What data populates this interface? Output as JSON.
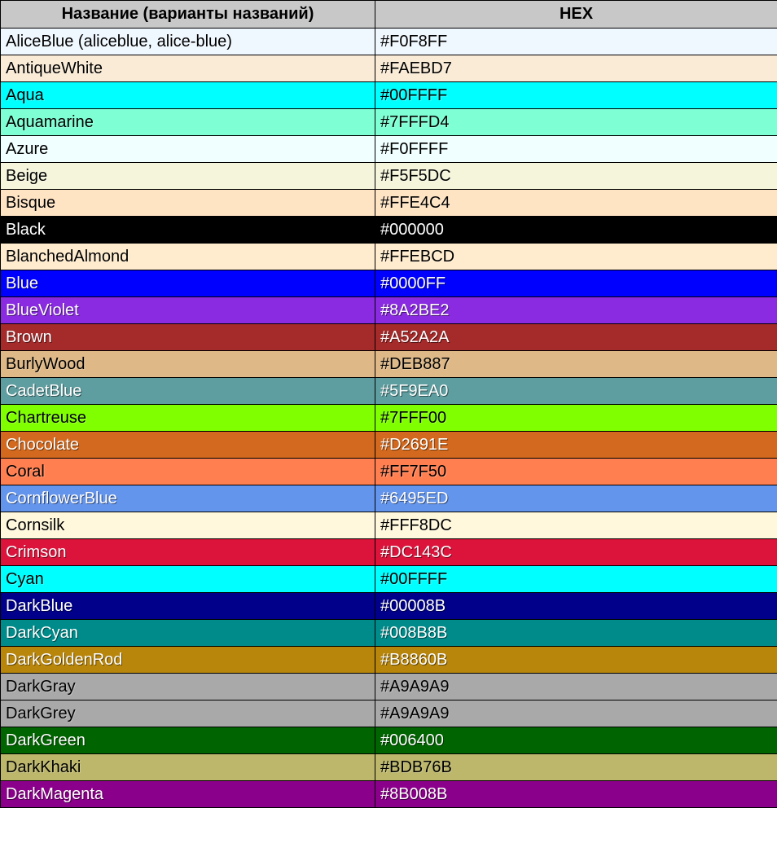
{
  "headers": {
    "name": "Название (варианты названий)",
    "hex": "HEX"
  },
  "rows": [
    {
      "label": "AliceBlue (aliceblue, alice-blue)",
      "hex": "#F0F8FF",
      "bg": "#F0F8FF",
      "fg": "#000000",
      "dark": false
    },
    {
      "label": "AntiqueWhite",
      "hex": "#FAEBD7",
      "bg": "#FAEBD7",
      "fg": "#000000",
      "dark": false
    },
    {
      "label": "Aqua",
      "hex": "#00FFFF",
      "bg": "#00FFFF",
      "fg": "#000000",
      "dark": false
    },
    {
      "label": "Aquamarine",
      "hex": "#7FFFD4",
      "bg": "#7FFFD4",
      "fg": "#000000",
      "dark": false
    },
    {
      "label": "Azure",
      "hex": "#F0FFFF",
      "bg": "#F0FFFF",
      "fg": "#000000",
      "dark": false
    },
    {
      "label": "Beige",
      "hex": "#F5F5DC",
      "bg": "#F5F5DC",
      "fg": "#000000",
      "dark": false
    },
    {
      "label": "Bisque",
      "hex": "#FFE4C4",
      "bg": "#FFE4C4",
      "fg": "#000000",
      "dark": false
    },
    {
      "label": "Black",
      "hex": "#000000",
      "bg": "#000000",
      "fg": "#FFFFFF",
      "dark": true
    },
    {
      "label": "BlanchedAlmond",
      "hex": "#FFEBCD",
      "bg": "#FFEBCD",
      "fg": "#000000",
      "dark": false
    },
    {
      "label": "Blue",
      "hex": "#0000FF",
      "bg": "#0000FF",
      "fg": "#FFFFFF",
      "dark": true
    },
    {
      "label": "BlueViolet",
      "hex": "#8A2BE2",
      "bg": "#8A2BE2",
      "fg": "#FFFFFF",
      "dark": true
    },
    {
      "label": "Brown",
      "hex": "#A52A2A",
      "bg": "#A52A2A",
      "fg": "#FFFFFF",
      "dark": true
    },
    {
      "label": "BurlyWood",
      "hex": "#DEB887",
      "bg": "#DEB887",
      "fg": "#000000",
      "dark": false
    },
    {
      "label": "CadetBlue",
      "hex": "#5F9EA0",
      "bg": "#5F9EA0",
      "fg": "#FFFFFF",
      "dark": true
    },
    {
      "label": "Chartreuse",
      "hex": "#7FFF00",
      "bg": "#7FFF00",
      "fg": "#000000",
      "dark": false
    },
    {
      "label": "Chocolate",
      "hex": "#D2691E",
      "bg": "#D2691E",
      "fg": "#FFFFFF",
      "dark": true
    },
    {
      "label": "Coral",
      "hex": "#FF7F50",
      "bg": "#FF7F50",
      "fg": "#000000",
      "dark": false
    },
    {
      "label": "CornflowerBlue",
      "hex": "#6495ED",
      "bg": "#6495ED",
      "fg": "#FFFFFF",
      "dark": true
    },
    {
      "label": "Cornsilk",
      "hex": "#FFF8DC",
      "bg": "#FFF8DC",
      "fg": "#000000",
      "dark": false
    },
    {
      "label": "Crimson",
      "hex": "#DC143C",
      "bg": "#DC143C",
      "fg": "#FFFFFF",
      "dark": true
    },
    {
      "label": "Cyan",
      "hex": "#00FFFF",
      "bg": "#00FFFF",
      "fg": "#000000",
      "dark": false
    },
    {
      "label": "DarkBlue",
      "hex": "#00008B",
      "bg": "#00008B",
      "fg": "#FFFFFF",
      "dark": true
    },
    {
      "label": "DarkCyan",
      "hex": "#008B8B",
      "bg": "#008B8B",
      "fg": "#FFFFFF",
      "dark": true
    },
    {
      "label": "DarkGoldenRod",
      "hex": "#B8860B",
      "bg": "#B8860B",
      "fg": "#FFFFFF",
      "dark": true
    },
    {
      "label": "DarkGray",
      "hex": "#A9A9A9",
      "bg": "#A9A9A9",
      "fg": "#000000",
      "dark": false
    },
    {
      "label": "DarkGrey",
      "hex": "#A9A9A9",
      "bg": "#A9A9A9",
      "fg": "#000000",
      "dark": false
    },
    {
      "label": "DarkGreen",
      "hex": "#006400",
      "bg": "#006400",
      "fg": "#FFFFFF",
      "dark": true
    },
    {
      "label": "DarkKhaki",
      "hex": "#BDB76B",
      "bg": "#BDB76B",
      "fg": "#000000",
      "dark": false
    },
    {
      "label": "DarkMagenta",
      "hex": "#8B008B",
      "bg": "#8B008B",
      "fg": "#FFFFFF",
      "dark": true
    }
  ]
}
